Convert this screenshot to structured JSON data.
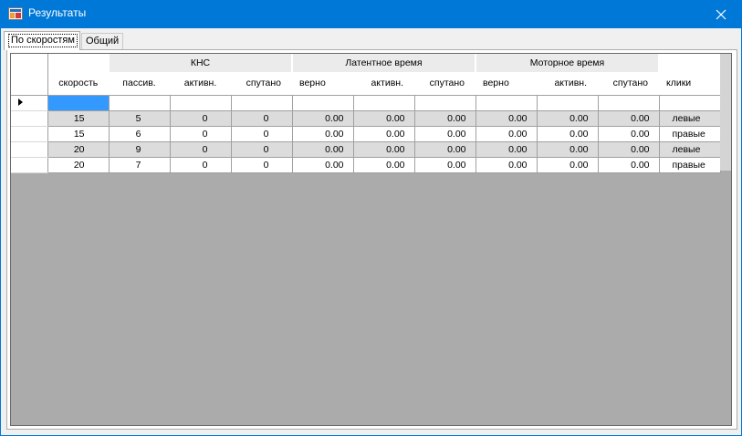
{
  "window": {
    "title": "Результаты"
  },
  "tabs": [
    {
      "label": "По скоростям",
      "active": true
    },
    {
      "label": "Общий",
      "active": false
    }
  ],
  "grid": {
    "group_headers": {
      "khs": "КНС",
      "latent": "Латентное время",
      "motor": "Моторное время"
    },
    "columns": [
      "скорость",
      "пассив.",
      "активн.",
      "спутано",
      "верно",
      "активн.",
      "спутано",
      "верно",
      "активн.",
      "спутано",
      "клики"
    ],
    "rows": [
      [
        "15",
        "5",
        "0",
        "0",
        "0.00",
        "0.00",
        "0.00",
        "0.00",
        "0.00",
        "0.00",
        "левые"
      ],
      [
        "15",
        "6",
        "0",
        "0",
        "0.00",
        "0.00",
        "0.00",
        "0.00",
        "0.00",
        "0.00",
        "правые"
      ],
      [
        "20",
        "9",
        "0",
        "0",
        "0.00",
        "0.00",
        "0.00",
        "0.00",
        "0.00",
        "0.00",
        "левые"
      ],
      [
        "20",
        "7",
        "0",
        "0",
        "0.00",
        "0.00",
        "0.00",
        "0.00",
        "0.00",
        "0.00",
        "правые"
      ]
    ],
    "colors": {
      "selection": "#3399ff",
      "alt_row": "#dcdcdc",
      "background": "#ababab"
    }
  },
  "icons": {
    "app": "app-icon",
    "close": "close-icon",
    "current_row": "current-row-arrow-icon"
  }
}
